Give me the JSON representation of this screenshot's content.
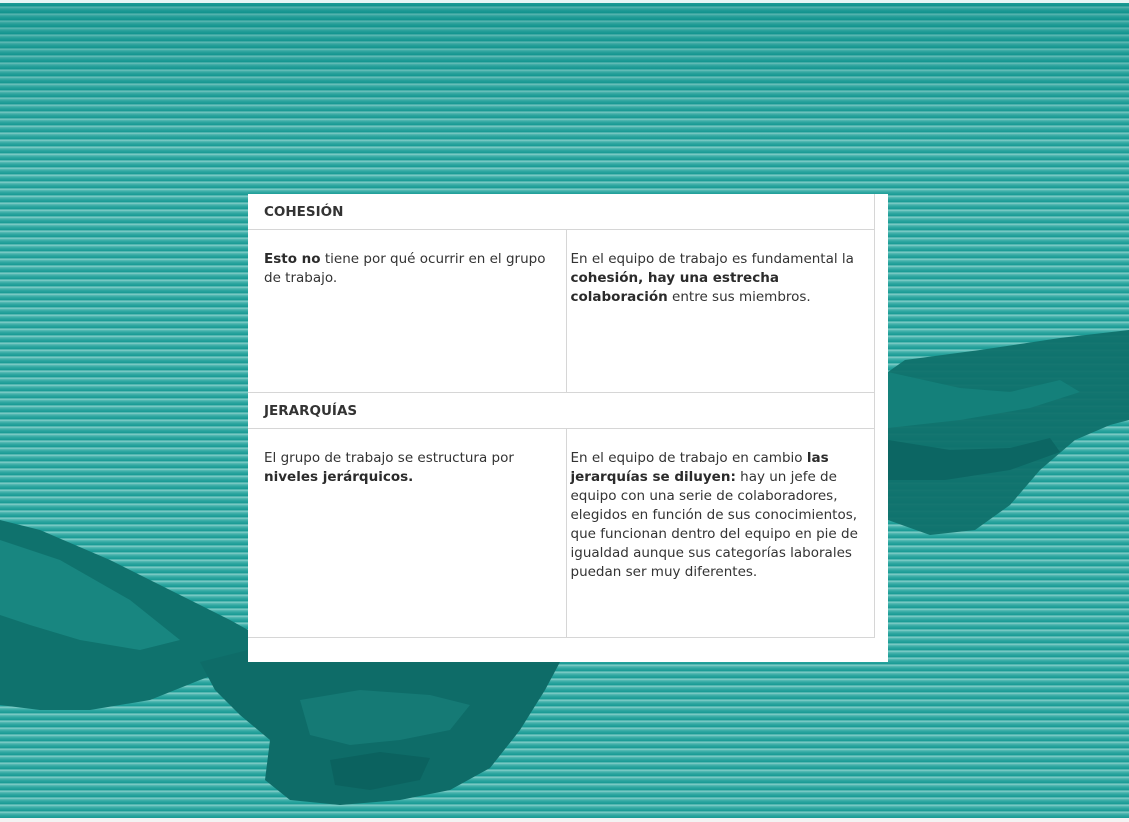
{
  "table": {
    "cohesion": {
      "heading": "COHESIÓN",
      "left": {
        "b1": "Esto no",
        "t1": " tiene por qué ocurrir en el grupo de trabajo."
      },
      "right": {
        "t1": "En el equipo de trabajo es fundamental la ",
        "b1": "cohesión, hay una estrecha colaboración",
        "t2": " entre sus miembros."
      }
    },
    "jerarquias": {
      "heading": "JERARQUÍAS",
      "left": {
        "t1": "El grupo de trabajo se estructura por ",
        "b1": "niveles jerárquicos."
      },
      "right": {
        "t1": "En el equipo de trabajo en cambio ",
        "b1": "las jerarquías se diluyen:",
        "t2": " hay un jefe de equipo con una serie de colaboradores, elegidos en función de sus conocimientos, que funcionan dentro del equipo en pie de igualdad aunque sus categorías laborales puedan ser muy diferentes."
      }
    }
  },
  "colors": {
    "background_teal": "#2fa7a1",
    "stripe_light": "#8fd3ce",
    "hand_dark": "#0e6f6b",
    "hand_mid": "#167d78",
    "panel": "#ffffff",
    "text": "#333333"
  }
}
